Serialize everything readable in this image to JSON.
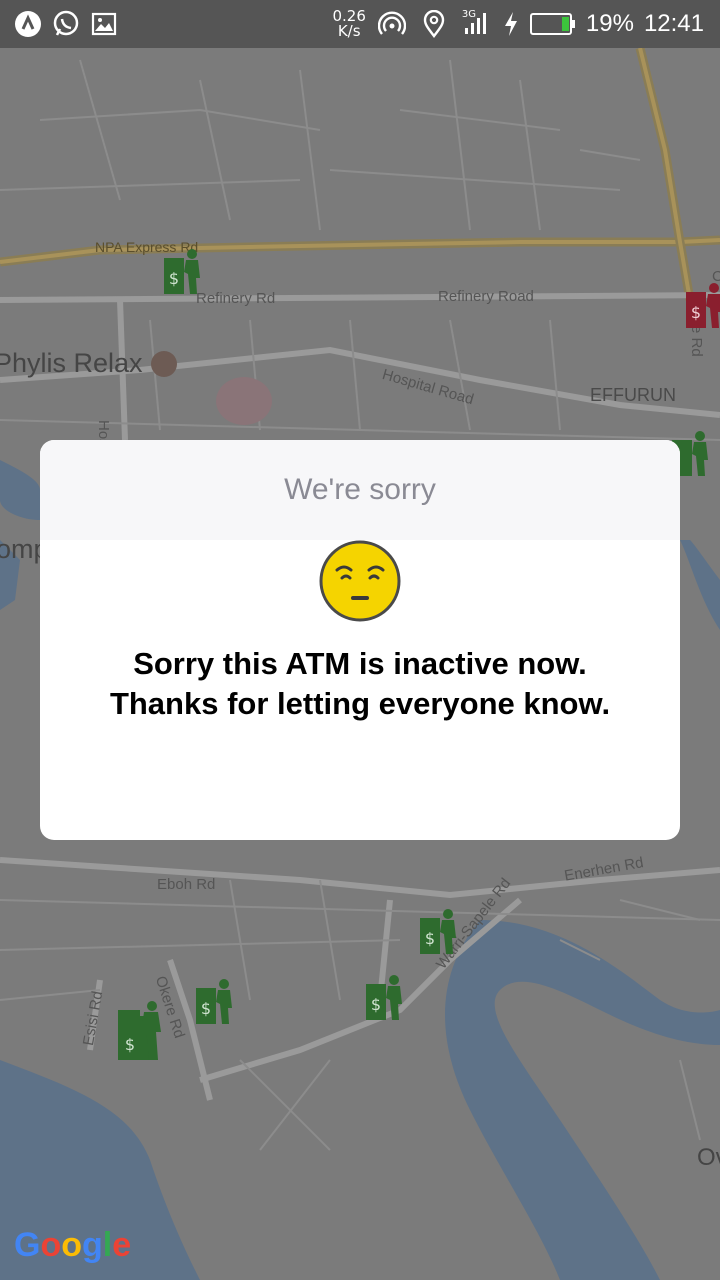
{
  "status_bar": {
    "net_speed": "0.26",
    "net_unit": "K/s",
    "network_type": "3G",
    "battery": "19%",
    "time": "12:41",
    "icons": [
      "app-logo-icon",
      "whatsapp-icon",
      "gallery-icon",
      "hotspot-icon",
      "location-icon",
      "signal-icon",
      "charging-icon",
      "battery-icon"
    ]
  },
  "map": {
    "labels": {
      "npa": "NPA Express Rd",
      "refinery_rd": "Refinery Rd",
      "refinery_road": "Refinery Road",
      "phylis": "Phylis Relax",
      "hospital": "Hospital Road",
      "effurun": "EFFURUN",
      "eboh": "Eboh Rd",
      "enerhen": "Enerhen Rd",
      "warri_sapele": "Warri-Sapele Rd",
      "okere": "Okere Rd",
      "esisi": "Esisi Rd",
      "ov": "Ov",
      "omp": "omp",
      "hos": "Hos",
      "erd": "e Rd",
      "c": "C"
    },
    "google": [
      "G",
      "o",
      "o",
      "g",
      "l",
      "e"
    ],
    "google_colors": [
      "#4285f4",
      "#ea4335",
      "#fbbc05",
      "#4285f4",
      "#34a853",
      "#ea4335"
    ]
  },
  "dialog": {
    "title": "We're sorry",
    "emoji": "confused-face",
    "message": "Sorry this ATM is inactive now. Thanks for letting everyone know."
  },
  "colors": {
    "atm_active": "#2e6b2e",
    "atm_inactive": "#8a1f2e"
  }
}
